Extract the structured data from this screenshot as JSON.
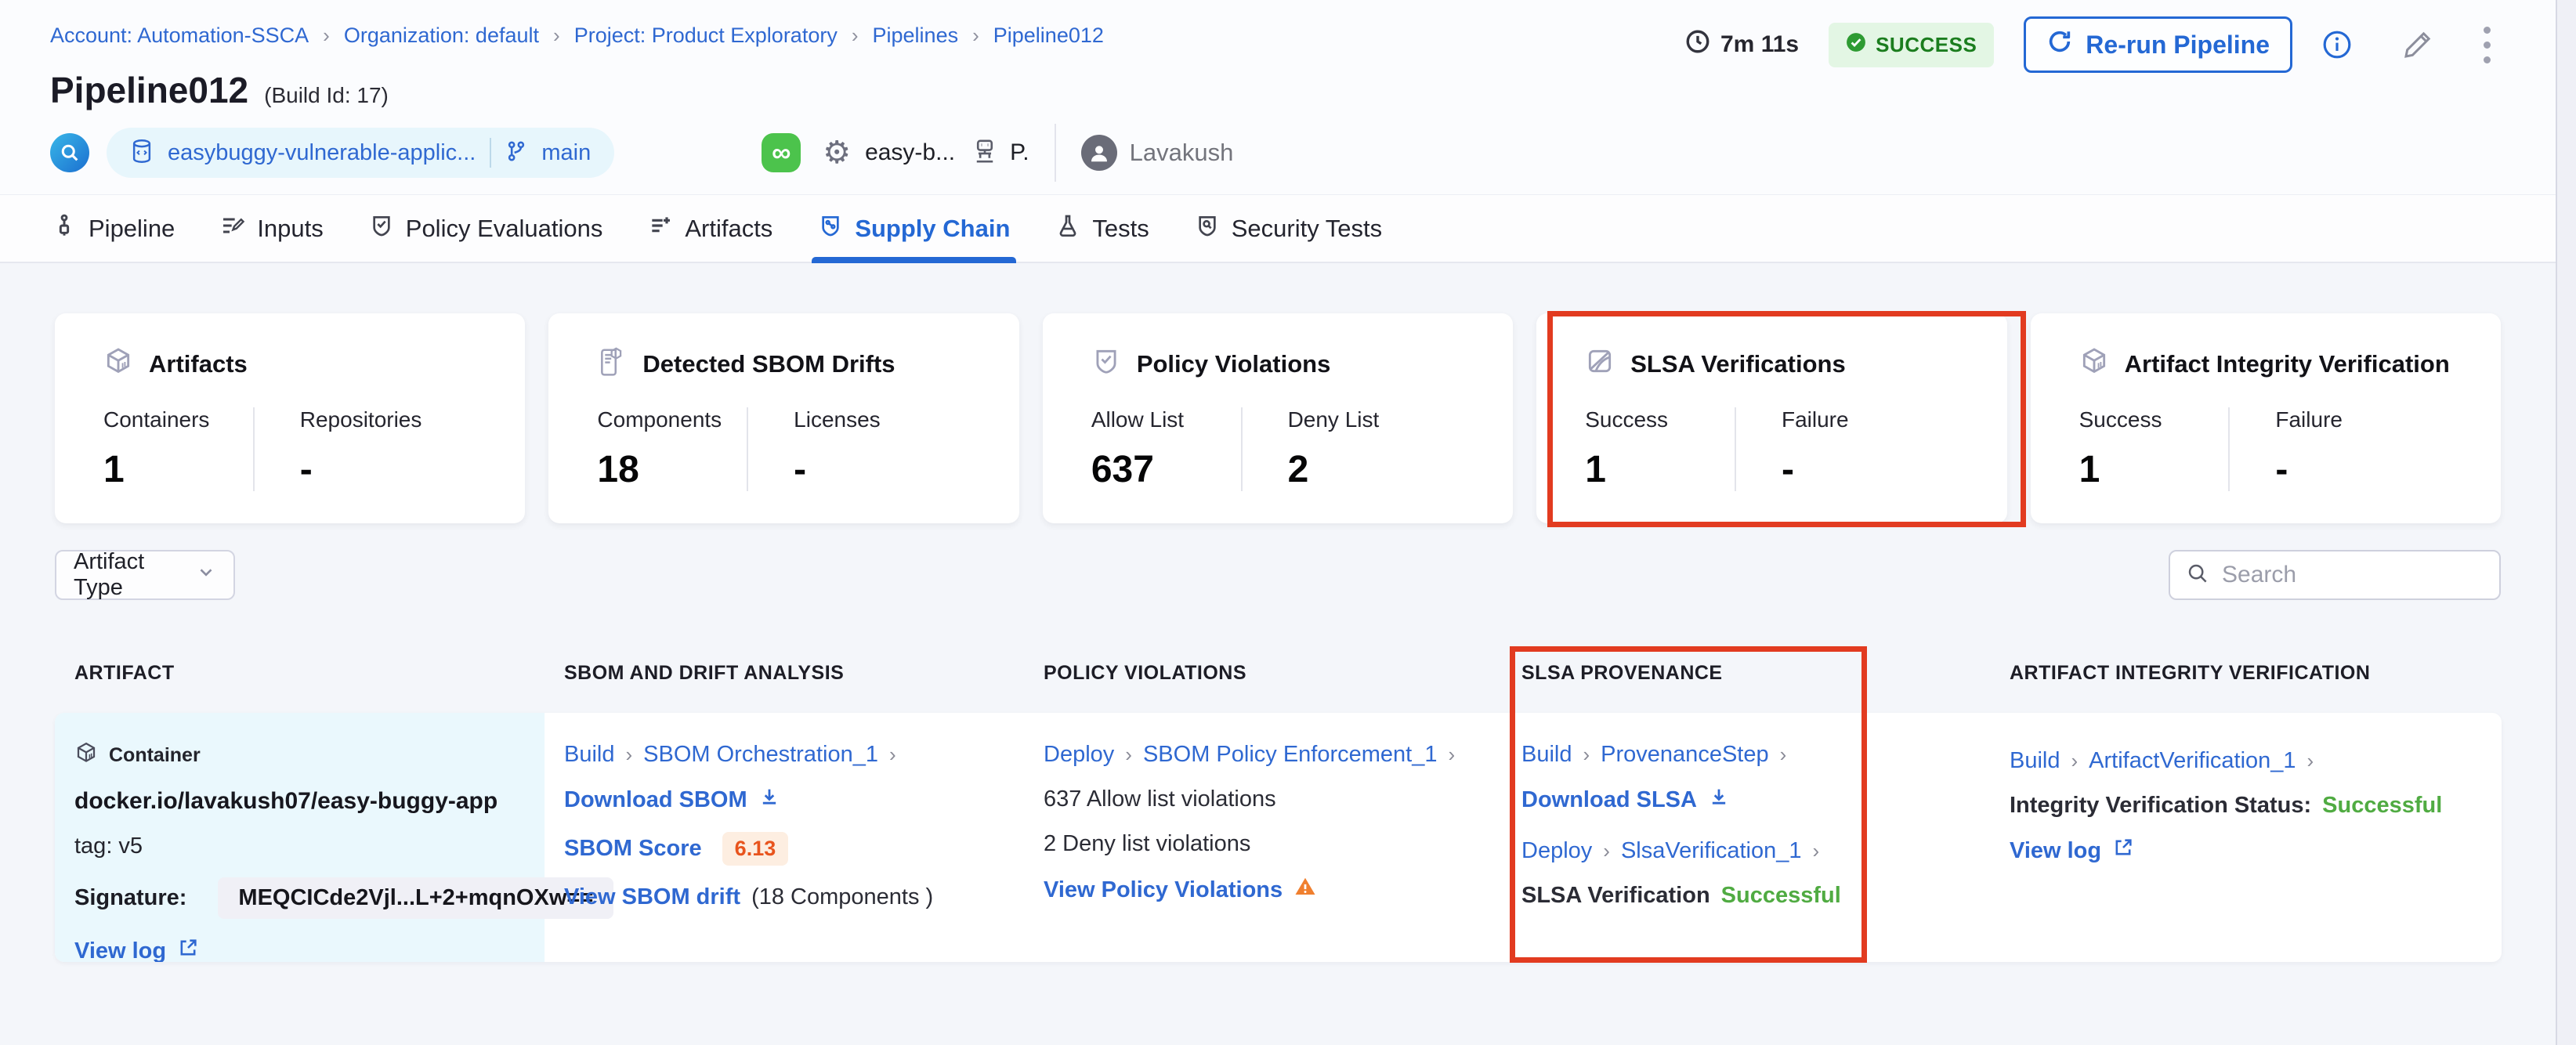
{
  "breadcrumb": {
    "items": [
      {
        "label": "Account: Automation-SSCA"
      },
      {
        "label": "Organization: default"
      },
      {
        "label": "Project: Product Exploratory"
      },
      {
        "label": "Pipelines"
      },
      {
        "label": "Pipeline012"
      }
    ]
  },
  "header": {
    "duration": "7m 11s",
    "status": "SUCCESS",
    "rerun_label": "Re-run Pipeline",
    "title": "Pipeline012",
    "build_id": "(Build Id: 17)",
    "codebase": {
      "repo": "easybuggy-vulnerable-applic...",
      "branch": "main",
      "link_glyph": "∞",
      "gear_glyph": "⚙",
      "service": "easy-b...",
      "initial": "P.",
      "user": "Lavakush"
    }
  },
  "tabs": [
    {
      "label": "Pipeline"
    },
    {
      "label": "Inputs"
    },
    {
      "label": "Policy Evaluations"
    },
    {
      "label": "Artifacts"
    },
    {
      "label": "Supply Chain"
    },
    {
      "label": "Tests"
    },
    {
      "label": "Security Tests"
    }
  ],
  "cards": [
    {
      "title": "Artifacts",
      "col1_label": "Containers",
      "col1_value": "1",
      "col2_label": "Repositories",
      "col2_value": "-"
    },
    {
      "title": "Detected SBOM Drifts",
      "col1_label": "Components",
      "col1_value": "18",
      "col2_label": "Licenses",
      "col2_value": "-"
    },
    {
      "title": "Policy Violations",
      "col1_label": "Allow List",
      "col1_value": "637",
      "col2_label": "Deny List",
      "col2_value": "2"
    },
    {
      "title": "SLSA Verifications",
      "col1_label": "Success",
      "col1_value": "1",
      "col2_label": "Failure",
      "col2_value": "-"
    },
    {
      "title": "Artifact Integrity Verification",
      "col1_label": "Success",
      "col1_value": "1",
      "col2_label": "Failure",
      "col2_value": "-"
    }
  ],
  "filters": {
    "artifact_type_label": "Artifact Type",
    "search_placeholder": "Search"
  },
  "table": {
    "headers": [
      "ARTIFACT",
      "SBOM AND DRIFT ANALYSIS",
      "POLICY VIOLATIONS",
      "SLSA PROVENANCE",
      "ARTIFACT INTEGRITY VERIFICATION"
    ],
    "row": {
      "artifact": {
        "type": "Container",
        "image": "docker.io/lavakush07/easy-buggy-app",
        "tag": "tag: v5",
        "signature_label": "Signature:",
        "signature": "MEQCICde2Vjl...L+2+mqnOXw==",
        "view_log": "View log"
      },
      "sbom": {
        "stage": "Build",
        "step": "SBOM Orchestration_1",
        "download": "Download SBOM",
        "score_label": "SBOM Score",
        "score": "6.13",
        "drift_link": "View SBOM drift",
        "drift_suffix": "(18 Components )"
      },
      "policy": {
        "stage": "Deploy",
        "step": "SBOM Policy Enforcement_1",
        "allow": "637 Allow list violations",
        "deny": "2 Deny list violations",
        "view": "View Policy Violations"
      },
      "slsa": {
        "stage1": "Build",
        "step1": "ProvenanceStep",
        "download": "Download SLSA",
        "stage2": "Deploy",
        "step2": "SlsaVerification_1",
        "status_label": "SLSA Verification",
        "status_value": "Successful"
      },
      "integrity": {
        "stage": "Build",
        "step": "ArtifactVerification_1",
        "status_label": "Integrity Verification Status:",
        "status_value": "Successful",
        "view_log": "View log"
      }
    }
  },
  "colors": {
    "accent_blue": "#2468d4",
    "link_blue": "#2f68d1",
    "success_green_text": "#1b7d1e",
    "success_green_bg": "#e3f6e4",
    "status_green": "#50ab42",
    "score_orange": "#e8541d",
    "highlight_red": "#e23b20",
    "artifact_cell_bg": "#eaf8fd",
    "page_bg": "#f4f6fa"
  }
}
